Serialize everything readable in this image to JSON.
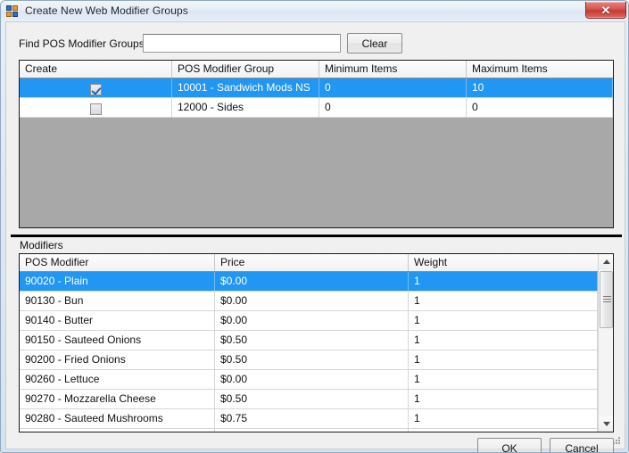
{
  "window": {
    "title": "Create New Web Modifier Groups",
    "icon": "app-icon",
    "close_label": "✕"
  },
  "search": {
    "label": "Find POS Modifier Groups",
    "value": "",
    "placeholder": "",
    "clear_label": "Clear"
  },
  "groups_grid": {
    "columns": [
      "Create",
      "POS Modifier Group",
      "Minimum Items",
      "Maximum Items"
    ],
    "rows": [
      {
        "create": true,
        "group": "10001 - Sandwich Mods NS",
        "minimum": "0",
        "maximum": "10",
        "selected": true
      },
      {
        "create": false,
        "group": "12000 - Sides",
        "minimum": "0",
        "maximum": "0",
        "selected": false
      }
    ]
  },
  "modifiers": {
    "section_label": "Modifiers",
    "columns": [
      "POS Modifier",
      "Price",
      "Weight"
    ],
    "rows": [
      {
        "modifier": "90020 - Plain",
        "price": "$0.00",
        "weight": "1",
        "selected": true
      },
      {
        "modifier": "90130 - Bun",
        "price": "$0.00",
        "weight": "1",
        "selected": false
      },
      {
        "modifier": "90140 - Butter",
        "price": "$0.00",
        "weight": "1",
        "selected": false
      },
      {
        "modifier": "90150 - Sauteed Onions",
        "price": "$0.50",
        "weight": "1",
        "selected": false
      },
      {
        "modifier": "90200 - Fried Onions",
        "price": "$0.50",
        "weight": "1",
        "selected": false
      },
      {
        "modifier": "90260 - Lettuce",
        "price": "$0.00",
        "weight": "1",
        "selected": false
      },
      {
        "modifier": "90270 - Mozzarella Cheese",
        "price": "$0.50",
        "weight": "1",
        "selected": false
      },
      {
        "modifier": "90280 - Sauteed Mushrooms",
        "price": "$0.75",
        "weight": "1",
        "selected": false
      },
      {
        "modifier": "",
        "price": "",
        "weight": "",
        "selected": false
      }
    ],
    "scrollbar": {
      "up": "scroll-up",
      "down": "scroll-down"
    }
  },
  "footer": {
    "ok_label": "OK",
    "cancel_label": "Cancel"
  },
  "colors": {
    "selection": "#2196f3",
    "grid_empty": "#a8a8a8",
    "dialog_face": "#f0f0f0",
    "close_red": "#c33b34"
  }
}
